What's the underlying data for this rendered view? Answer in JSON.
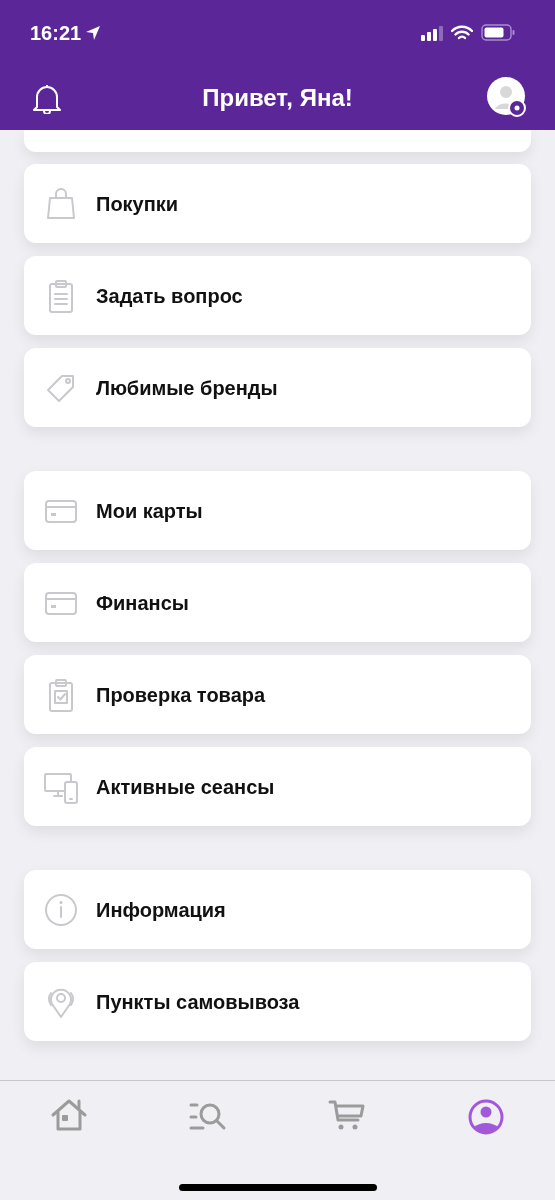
{
  "status_bar": {
    "time": "16:21"
  },
  "header": {
    "title": "Привет, Яна!"
  },
  "menu_groups": [
    {
      "items": [
        {
          "kind": "bag",
          "label": "Покупки"
        },
        {
          "kind": "clipboard",
          "label": "Задать вопрос"
        },
        {
          "kind": "tag",
          "label": "Любимые бренды"
        }
      ]
    },
    {
      "items": [
        {
          "kind": "card",
          "label": "Мои карты"
        },
        {
          "kind": "card",
          "label": "Финансы"
        },
        {
          "kind": "check",
          "label": "Проверка товара"
        },
        {
          "kind": "devices",
          "label": "Активные сеансы"
        }
      ]
    },
    {
      "items": [
        {
          "kind": "info",
          "label": "Информация"
        },
        {
          "kind": "pin",
          "label": "Пункты самовывоза"
        }
      ]
    }
  ],
  "tab_bar": [
    {
      "kind": "home",
      "selected": false
    },
    {
      "kind": "search",
      "selected": false
    },
    {
      "kind": "cart",
      "selected": false
    },
    {
      "kind": "profile",
      "selected": true
    }
  ]
}
